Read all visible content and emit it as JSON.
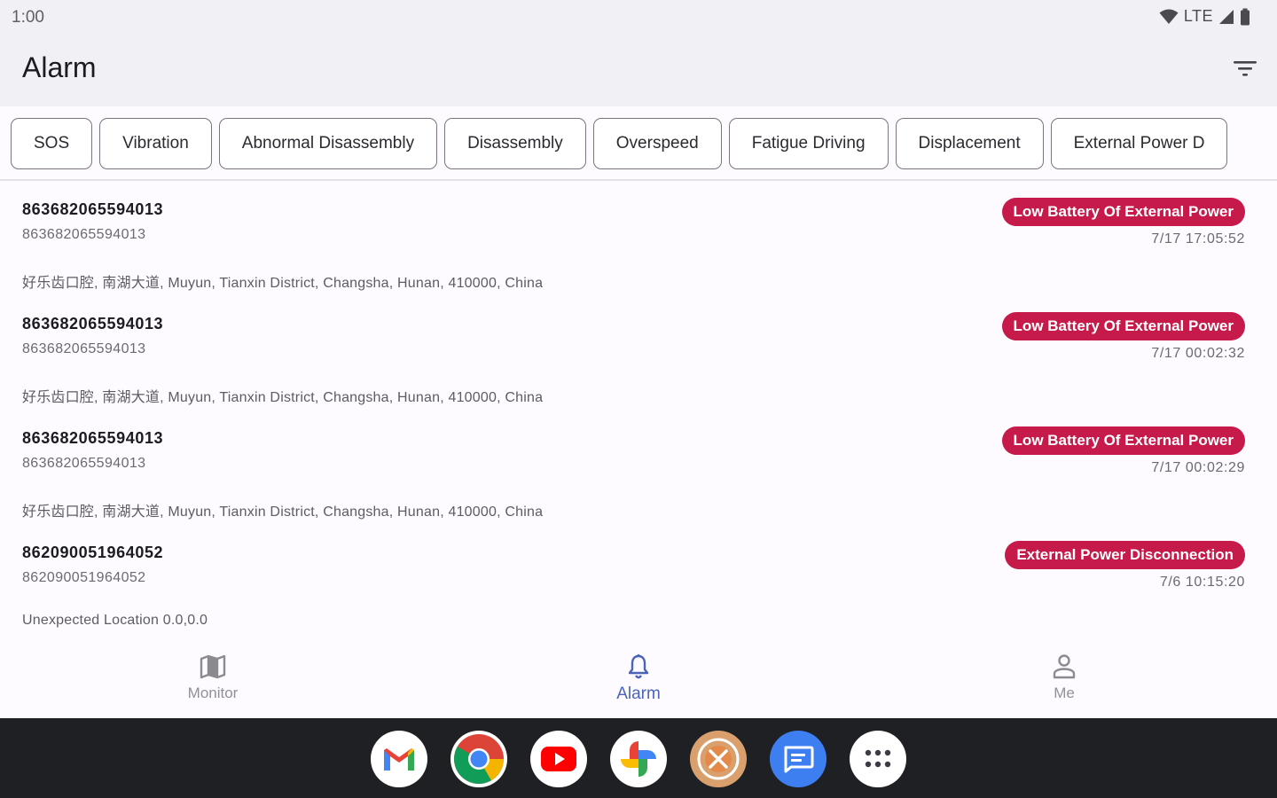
{
  "status_bar": {
    "time": "1:00",
    "network": "LTE"
  },
  "header": {
    "title": "Alarm"
  },
  "filter_chips": [
    "SOS",
    "Vibration",
    "Abnormal Disassembly",
    "Disassembly",
    "Overspeed",
    "Fatigue Driving",
    "Displacement",
    "External Power D"
  ],
  "alarms": [
    {
      "device": "863682065594013",
      "imei": "863682065594013",
      "type": "Low Battery Of External Power",
      "time": "7/17 17:05:52",
      "address": "好乐齿口腔, 南湖大道, Muyun, Tianxin District, Changsha, Hunan, 410000, China"
    },
    {
      "device": "863682065594013",
      "imei": "863682065594013",
      "type": "Low Battery Of External Power",
      "time": "7/17 00:02:32",
      "address": "好乐齿口腔, 南湖大道, Muyun, Tianxin District, Changsha, Hunan, 410000, China"
    },
    {
      "device": "863682065594013",
      "imei": "863682065594013",
      "type": "Low Battery Of External Power",
      "time": "7/17 00:02:29",
      "address": "好乐齿口腔, 南湖大道, Muyun, Tianxin District, Changsha, Hunan, 410000, China"
    },
    {
      "device": "862090051964052",
      "imei": "862090051964052",
      "type": "External Power Disconnection",
      "time": "7/6 10:15:20",
      "address": "Unexpected Location 0.0,0.0"
    }
  ],
  "bottom_nav": [
    {
      "label": "Monitor",
      "icon": "map-icon"
    },
    {
      "label": "Alarm",
      "icon": "bell-icon",
      "active": true
    },
    {
      "label": "Me",
      "icon": "person-icon"
    }
  ],
  "dock_apps": [
    "gmail-icon",
    "chrome-icon",
    "youtube-icon",
    "photos-icon",
    "app-icon",
    "messages-icon",
    "app-drawer-icon"
  ],
  "colors": {
    "badge": "#c51a4a",
    "active_nav": "#4b64b8",
    "taskbar": "#1f2024"
  }
}
